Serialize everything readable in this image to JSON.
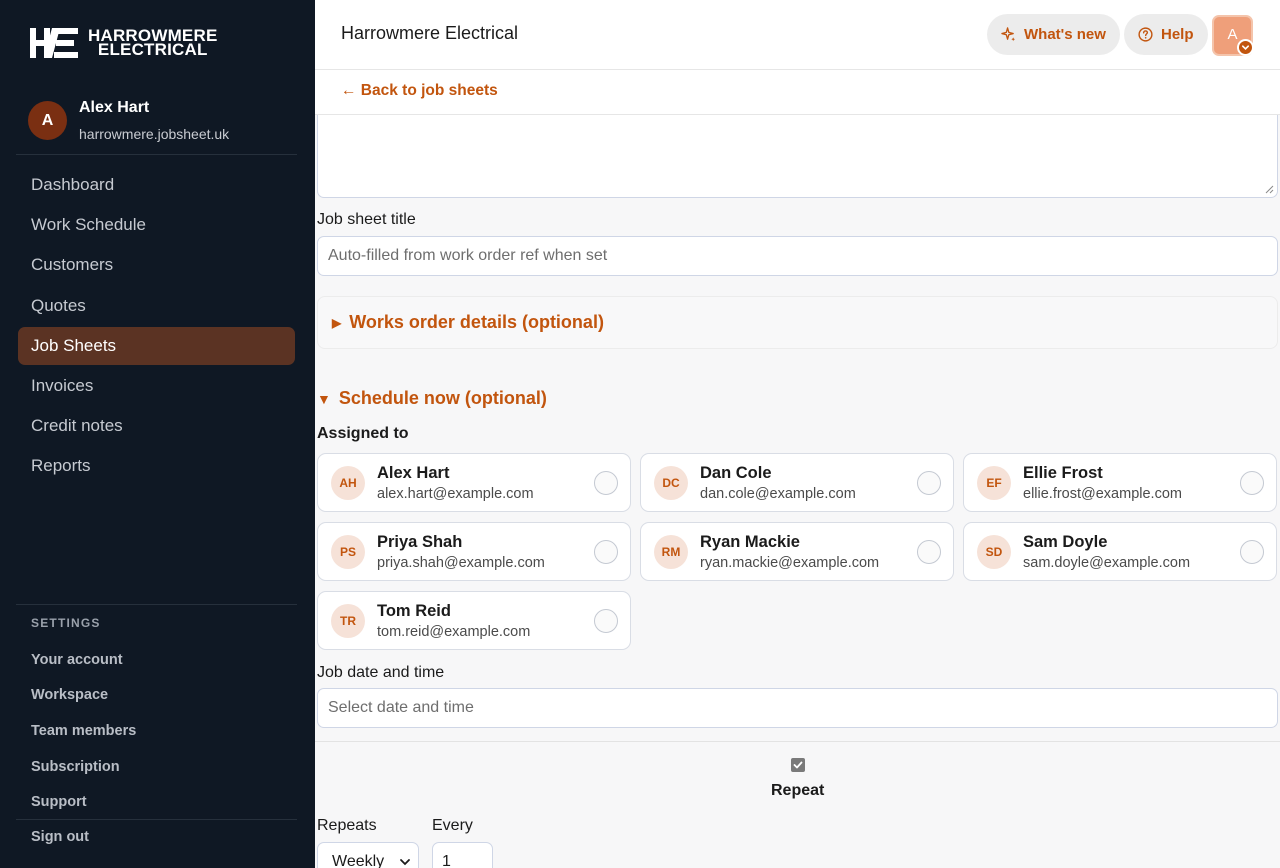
{
  "brand": {
    "logo_mark": "HE",
    "logo_line1": "HARROWMERE",
    "logo_line2": "ELECTRICAL"
  },
  "user": {
    "initial": "A",
    "name": "Alex Hart",
    "domain": "harrowmere.jobsheet.uk"
  },
  "nav": [
    {
      "label": "Dashboard"
    },
    {
      "label": "Work Schedule"
    },
    {
      "label": "Customers"
    },
    {
      "label": "Quotes"
    },
    {
      "label": "Job Sheets",
      "active": true
    },
    {
      "label": "Invoices"
    },
    {
      "label": "Credit notes"
    },
    {
      "label": "Reports"
    }
  ],
  "settings": {
    "heading": "SETTINGS",
    "items": [
      {
        "label": "Your account"
      },
      {
        "label": "Workspace"
      },
      {
        "label": "Team members"
      },
      {
        "label": "Subscription"
      },
      {
        "label": "Support"
      }
    ],
    "sign_out": "Sign out"
  },
  "header": {
    "title": "Harrowmere Electrical",
    "whats_new": "What's new",
    "help": "Help",
    "avatar_initial": "A"
  },
  "back_link": "← Back to job sheets",
  "form": {
    "job_title_label": "Job sheet title",
    "job_title_placeholder": "Auto-filled from work order ref when set",
    "works_order_summary": "Works order details (optional)",
    "schedule_summary": "Schedule now (optional)",
    "assigned_label": "Assigned to",
    "assignees": [
      {
        "initials": "AH",
        "name": "Alex Hart",
        "email": "alex.hart@example.com"
      },
      {
        "initials": "DC",
        "name": "Dan Cole",
        "email": "dan.cole@example.com"
      },
      {
        "initials": "EF",
        "name": "Ellie Frost",
        "email": "ellie.frost@example.com"
      },
      {
        "initials": "PS",
        "name": "Priya Shah",
        "email": "priya.shah@example.com"
      },
      {
        "initials": "RM",
        "name": "Ryan Mackie",
        "email": "ryan.mackie@example.com"
      },
      {
        "initials": "SD",
        "name": "Sam Doyle",
        "email": "sam.doyle@example.com"
      },
      {
        "initials": "TR",
        "name": "Tom Reid",
        "email": "tom.reid@example.com"
      }
    ],
    "date_label": "Job date and time",
    "date_placeholder": "Select date and time",
    "repeat_label": "Repeat",
    "repeat_checked": true,
    "repeats_label": "Repeats",
    "repeats_value": "Weekly",
    "every_label": "Every",
    "every_value": "1"
  },
  "colors": {
    "accent": "#c2550e",
    "sidebar_bg": "#0f1824",
    "active_nav": "#5b3323"
  }
}
